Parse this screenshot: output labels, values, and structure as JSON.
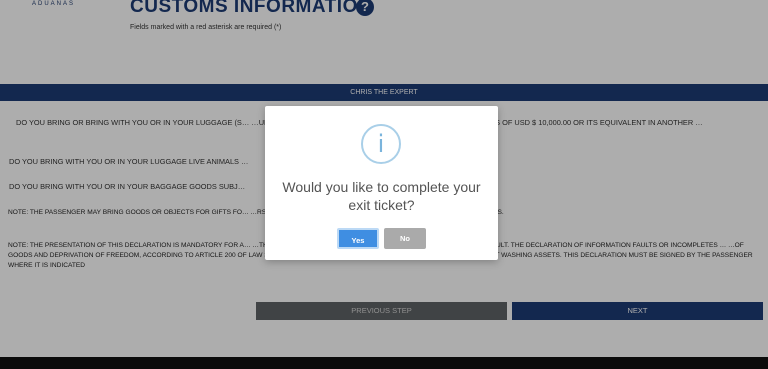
{
  "header": {
    "logo_text": "ADUANAS",
    "title": "CUSTOMS INFORMATION",
    "help_glyph": "?",
    "subtitle": "Fields marked with a red asterisk are required (*)"
  },
  "expert_bar": {
    "label": "CHRIS THE EXPERT"
  },
  "questions": {
    "q1": "DO YOU BRING OR BRING WITH YOU OR IN YOUR LUGGAGE (S… …UES OR ANOTHER PAYMENT INSTRUMENT, AN AMOUNT IN EXCESS OF USD $ 10,000.00 OR ITS EQUIVALENT IN ANOTHER …",
    "q2": "DO YOU BRING WITH YOU OR IN YOUR LUGGAGE LIVE ANIMALS …",
    "q3": "DO YOU BRING WITH YOU OR IN YOUR BAGGAGE GOODS SUBJ…"
  },
  "notes": {
    "note1": "NOTE: THE PASSENGER MAY BRING GOODS OR OBJECTS FOR GIFTS FO… …RS). THIS EASE CAN ONLY BE USED AND APPLIED ONCE EVERY (3) MONTHS.",
    "note2": "NOTE: THE PRESENTATION OF THIS DECLARATION IS MANDATORY FOR A… …THIS FORM MUST BE COMPLETED AND SIGNED BY THE RESPONSIBLE ADULT. THE DECLARATION OF INFORMATION FAULTS OR INCOMPLETES … …OF GOODS AND DEPRIVATION OF FREEDOM, ACCORDING TO ARTICLE 200 OF LAW 3489, OF CUSTOMS REGIME, AND ARTICLE 4 OF LAW NO. 155-17 AGAINST WASHING ASSETS. THIS DECLARATION MUST BE SIGNED BY THE PASSENGER WHERE IT IS INDICATED"
  },
  "buttons": {
    "previous": "PREVIOUS STEP",
    "next": "NEXT"
  },
  "dialog": {
    "icon_glyph": "i",
    "message": "Would you like to complete your exit ticket?",
    "yes_label": "Yes",
    "no_label": "No"
  },
  "colors": {
    "primary_navy": "#1d3b75",
    "yes_blue": "#3f8ee2",
    "no_gray": "#aaaaaa",
    "info_blue": "#a9cfe8"
  }
}
